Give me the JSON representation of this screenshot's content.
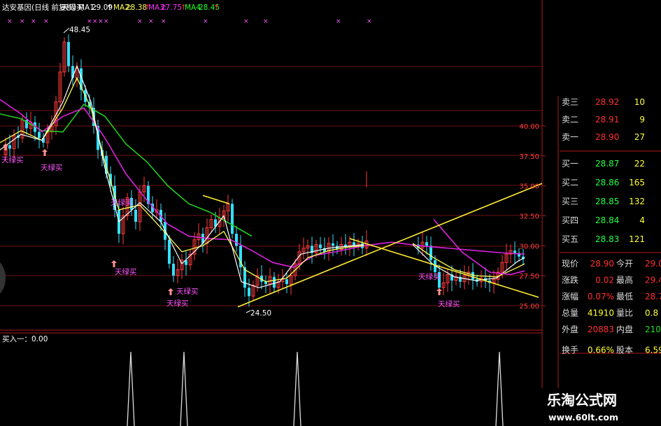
{
  "header": {
    "title": "达安基因(日线 前复权)",
    "formula": "天绿买",
    "ma1": {
      "label": "MA1:",
      "value": "29.09",
      "color": "#ffffff"
    },
    "ma2": {
      "label": "MA2:",
      "value": "28.38",
      "color": "#ffff55"
    },
    "ma3": {
      "label": "MA3:",
      "value": "27.75",
      "color": "#ff33ff"
    },
    "ma4": {
      "label": "MA4:",
      "value": "28.45",
      "color": "#22ff22"
    }
  },
  "annotations": {
    "high": "48.45",
    "low": "24.50",
    "signal_label": "天绿买"
  },
  "price_axis": {
    "labels": [
      "40.00",
      "37.50",
      "35.00",
      "32.50",
      "30.00",
      "27.50",
      "25.00"
    ],
    "values": [
      40.0,
      37.5,
      35.0,
      32.5,
      30.0,
      27.5,
      25.0
    ]
  },
  "indicator_panel": {
    "label": "买入一：0.00"
  },
  "order_book": {
    "asks": [
      {
        "label": "卖三",
        "price": "28.92",
        "vol": "10"
      },
      {
        "label": "卖二",
        "price": "28.91",
        "vol": "9"
      },
      {
        "label": "卖一",
        "price": "28.90",
        "vol": "27"
      }
    ],
    "bids": [
      {
        "label": "买一",
        "price": "28.87",
        "vol": "22"
      },
      {
        "label": "买二",
        "price": "28.86",
        "vol": "165"
      },
      {
        "label": "买三",
        "price": "28.85",
        "vol": "132"
      },
      {
        "label": "买四",
        "price": "28.84",
        "vol": "4"
      },
      {
        "label": "买五",
        "price": "28.83",
        "vol": "121"
      }
    ]
  },
  "quote": {
    "rows": [
      {
        "l1": "现价",
        "v1": "28.90",
        "c1": "#ff3030",
        "l2": "今开",
        "v2": "29.0",
        "c2": "#ff3030"
      },
      {
        "l1": "涨跌",
        "v1": "0.02",
        "c1": "#ff3030",
        "l2": "最高",
        "v2": "29.4",
        "c2": "#ff3030"
      },
      {
        "l1": "涨幅",
        "v1": "0.07%",
        "c1": "#ff3030",
        "l2": "最低",
        "v2": "28.7",
        "c2": "#ff3030"
      },
      {
        "l1": "总量",
        "v1": "41910",
        "c1": "#ffff33",
        "l2": "量比",
        "v2": "0.8",
        "c2": "#ffff33"
      },
      {
        "l1": "外盘",
        "v1": "20883",
        "c1": "#ff3030",
        "l2": "内盘",
        "v2": "2102",
        "c2": "#22dd22"
      },
      {
        "l1": "换手",
        "v1": "0.66%",
        "c1": "#ffff33",
        "l2": "股本",
        "v2": "6.59",
        "c2": "#ffff33"
      }
    ]
  },
  "watermark": {
    "title": "乐淘公式网",
    "url": "www.60lt.com"
  },
  "colors": {
    "up": "#ff3b3b",
    "down": "#33e0ff",
    "ma1": "#ffffff",
    "ma2": "#ffff55",
    "ma3": "#dd22dd",
    "ma4": "#22cc22",
    "signal": "#ff55ff",
    "trendline": "#ffee33",
    "grid": "#6e1212"
  }
}
